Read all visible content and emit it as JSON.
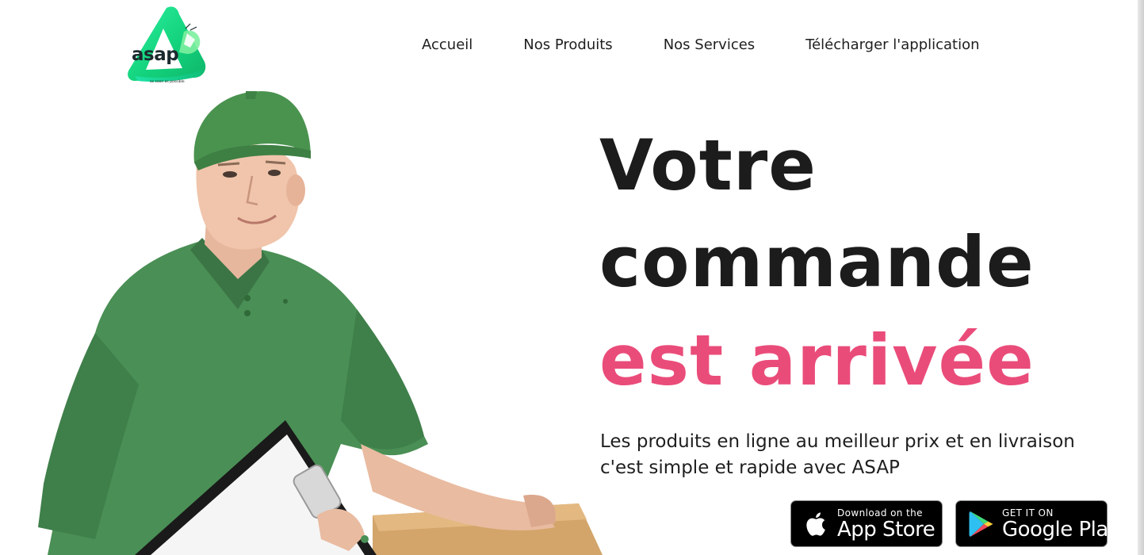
{
  "logo": {
    "word": "asap",
    "tagline": "as soon as possible",
    "icon": "asap-triangle-logo-icon"
  },
  "nav": {
    "items": [
      {
        "label": "Accueil"
      },
      {
        "label": "Nos Produits"
      },
      {
        "label": "Nos Services"
      },
      {
        "label": "Télécharger l'application"
      }
    ]
  },
  "hero": {
    "line1": "Votre",
    "line2": "commande",
    "line3": "est arrivée",
    "subtitle": "Les produits en ligne au meilleur prix et en livraison c'est simple et rapide avec ASAP",
    "illustration": "delivery-man-holding-clipboard-and-box-image"
  },
  "badges": {
    "apple": {
      "small": "Download on the",
      "big": "App Store",
      "icon": "apple-icon"
    },
    "google": {
      "small": "GET IT ON",
      "big": "Google Play",
      "icon": "google-play-icon"
    }
  },
  "colors": {
    "accent_pink": "#ea4c7a",
    "logo_green": "#1ee08a",
    "shirt_green": "#4a8f55",
    "text_dark": "#1c1c1c"
  }
}
